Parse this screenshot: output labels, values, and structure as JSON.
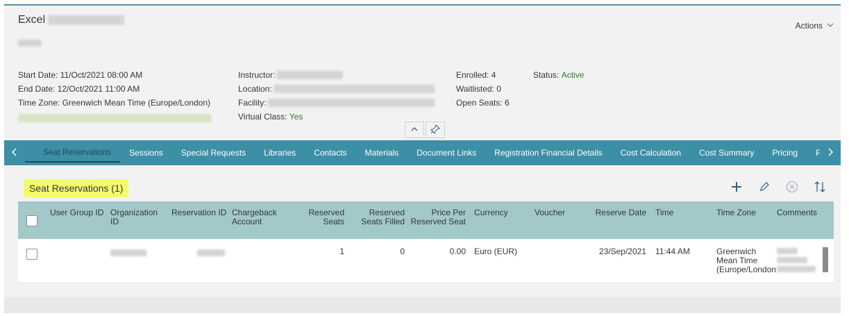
{
  "header": {
    "title": "Excel",
    "actions_label": "Actions",
    "start_date": "Start Date: 11/Oct/2021 08:00 AM",
    "end_date": "End Date: 12/Oct/2021 11:00 AM",
    "time_zone": "Time Zone: Greenwich Mean Time (Europe/London)",
    "instructor_label": "Instructor:",
    "location_label": "Location:",
    "facility_label": "Facility:",
    "virtual_label": "Virtual Class:",
    "virtual_value": "Yes",
    "enrolled": "Enrolled: 4",
    "waitlisted": "Waitlisted: 0",
    "open_seats": "Open Seats: 6",
    "status_label": "Status:",
    "status_value": "Active"
  },
  "tabs": [
    {
      "label": "Seat Reservations"
    },
    {
      "label": "Sessions"
    },
    {
      "label": "Special Requests"
    },
    {
      "label": "Libraries"
    },
    {
      "label": "Contacts"
    },
    {
      "label": "Materials"
    },
    {
      "label": "Document Links"
    },
    {
      "label": "Registration Financial Details"
    },
    {
      "label": "Cost Calculation"
    },
    {
      "label": "Cost Summary"
    },
    {
      "label": "Pricing"
    },
    {
      "label": "Purchasing"
    }
  ],
  "section": {
    "title": "Seat Reservations (1)"
  },
  "table": {
    "columns": {
      "user_group_id": "User Group ID",
      "organization_id_1": "Organization",
      "organization_id_2": "ID",
      "reservation_id": "Reservation ID",
      "chargeback_1": "Chargeback",
      "chargeback_2": "Account",
      "reserved_seats_1": "Reserved",
      "reserved_seats_2": "Seats",
      "seats_filled_1": "Reserved",
      "seats_filled_2": "Seats Filled",
      "price_1": "Price Per",
      "price_2": "Reserved Seat",
      "currency": "Currency",
      "voucher": "Voucher",
      "reserve_date": "Reserve Date",
      "time": "Time",
      "time_zone": "Time Zone",
      "comments": "Comments"
    },
    "rows": [
      {
        "reserved_seats": "1",
        "seats_filled": "0",
        "price": "0.00",
        "currency": "Euro (EUR)",
        "reserve_date": "23/Sep/2021",
        "time": "11:44 AM",
        "tz_1": "Greenwich",
        "tz_2": "Mean Time",
        "tz_3": "(Europe/London"
      }
    ]
  }
}
